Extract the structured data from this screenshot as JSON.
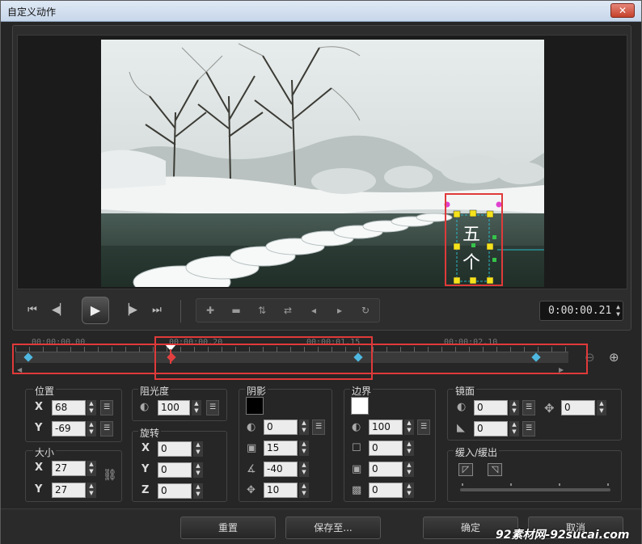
{
  "window": {
    "title": "自定义动作",
    "close_icon": "close-icon"
  },
  "preview": {
    "overlay_text": "五个字",
    "colors": {
      "selection_box": "#e03a3a",
      "handle": "#f5e21b",
      "guide": "#2ab8c8"
    }
  },
  "playback": {
    "timecode": "0:00:00.21",
    "buttons": [
      "home-icon",
      "prev-frame-icon",
      "play-icon",
      "next-frame-icon",
      "end-icon"
    ],
    "keyframe_tools": [
      "add-keyframe-icon",
      "remove-keyframe-icon",
      "invert-keyframe-icon",
      "swap-keyframe-icon",
      "move-left-icon",
      "move-right-icon",
      "reset-keyframe-icon"
    ]
  },
  "timeline": {
    "labels": [
      "00:00:00.00",
      "00:00:00.20",
      "00:00:01.15",
      "00:00:02.10"
    ],
    "keyframe_color": "#4fb8e0",
    "zoom_out_icon": "zoom-out-icon",
    "zoom_in_icon": "zoom-in-icon"
  },
  "position": {
    "title": "位置",
    "x_label": "X",
    "x_value": "68",
    "y_label": "Y",
    "y_value": "-69"
  },
  "size": {
    "title": "大小",
    "x_label": "X",
    "x_value": "27",
    "y_label": "Y",
    "y_value": "27"
  },
  "opacity": {
    "title": "阻光度",
    "value": "100"
  },
  "rotation": {
    "title": "旋转",
    "x_label": "X",
    "x_value": "0",
    "y_label": "Y",
    "y_value": "0",
    "z_label": "Z",
    "z_value": "0"
  },
  "shadow": {
    "title": "阴影",
    "color": "#000000",
    "opacity": "0",
    "blur": "15",
    "angle": "-40",
    "distance": "10"
  },
  "border": {
    "title": "边界",
    "color": "#ffffff",
    "opacity": "100",
    "v1": "0",
    "v2": "0",
    "v3": "0"
  },
  "mirror": {
    "title": "镜面",
    "opacity": "0",
    "offset": "0",
    "distance": "0"
  },
  "ease": {
    "title": "缓入/缓出"
  },
  "footer": {
    "reset": "重置",
    "save_to": "保存至...",
    "ok": "确定",
    "cancel": "取消",
    "watermark": "92素材网-92sucai.com"
  }
}
